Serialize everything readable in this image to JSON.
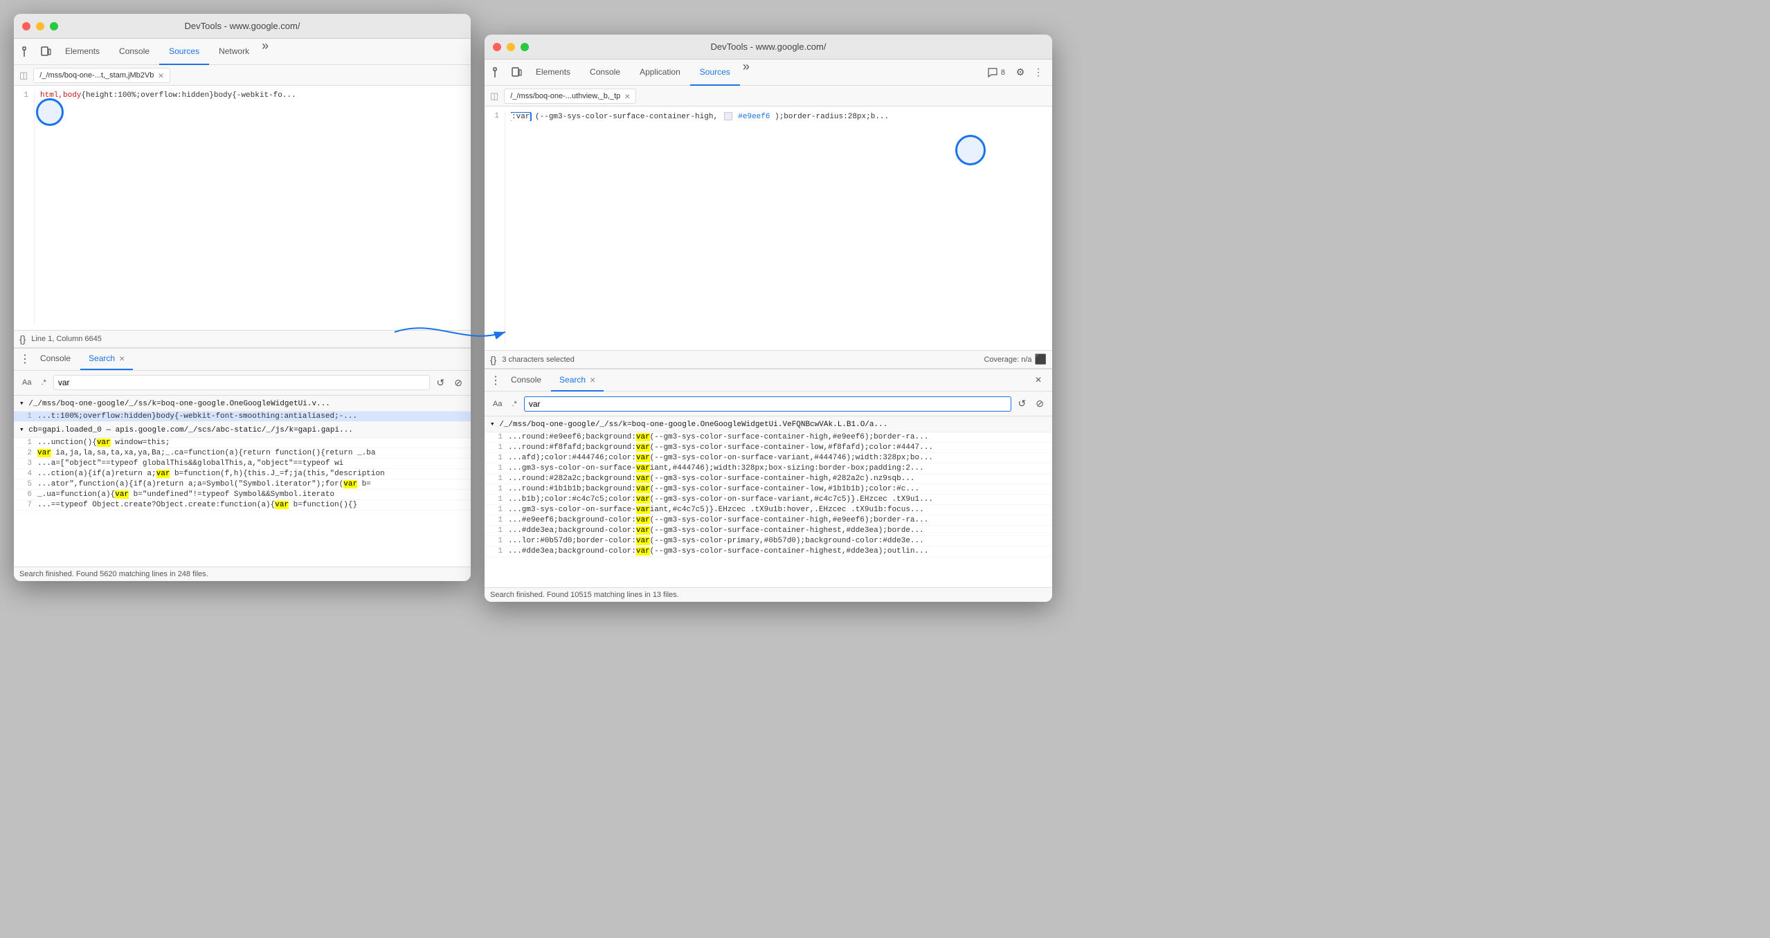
{
  "left_window": {
    "title": "DevTools - www.google.com/",
    "tabs": [
      {
        "label": "Elements",
        "active": false
      },
      {
        "label": "Console",
        "active": false
      },
      {
        "label": "Sources",
        "active": true
      },
      {
        "label": "Network",
        "active": false
      }
    ],
    "more_tabs": "»",
    "file_tab": "/_/mss/boq-one-...t,_stam,jMb2Vb",
    "line_number": "1",
    "source_line": "html,body{height:100%;overflow:hidden}body{-webkit-fo...",
    "status": "Line 1, Column 6645",
    "bottom_tabs": [
      {
        "label": "Console",
        "active": false
      },
      {
        "label": "Search",
        "active": true
      }
    ],
    "search": {
      "aa_label": "Aa",
      "regex_label": ".*",
      "input_value": "var",
      "refresh_btn": "↺",
      "clear_btn": "⊘"
    },
    "search_results": {
      "file1": {
        "path": "▾ /_/mss/boq-one-google/_/ss/k=boq-one-google.OneGoogleWidgetUi.v...",
        "lines": [
          {
            "num": "1",
            "text": "...t:100%;overflow:hidden}body{-webkit-font-smoothing:antialiased;-...",
            "highlight_word": "var"
          }
        ]
      },
      "file2": {
        "path": "▾ cb=gapi.loaded_0  —  apis.google.com/_/scs/abc-static/_/js/k=gapi.gapi...",
        "lines": [
          {
            "num": "1",
            "text": "...unction(){",
            "highlight_word": "var",
            "text_after": " window=this;"
          },
          {
            "num": "2",
            "text": "",
            "highlight_word": "var",
            "text_prefix": " ia,ja,la,sa,ta,xa,ya,Ba;_.ca=function(a){return function(){return _ba"
          },
          {
            "num": "3",
            "text": "...a=[\"object\"==typeof globalThis&&globalThis,a,\"object\"==typeof wi",
            "highlight_word": ""
          },
          {
            "num": "4",
            "text": "...ction(a){if(a)return a;",
            "highlight_word": "var",
            "text_after": " b=function(f,h){this.J_=f;ja(this,\"description"
          },
          {
            "num": "5",
            "text": "...ator\",function(a){if(a)return a;a=Symbol(\"Symbol.iterator\");for(",
            "highlight_word": "var",
            "text_after": " b="
          },
          {
            "num": "6",
            "text": "_.ua=function(a){",
            "highlight_word": "var",
            "text_after": " b=\"undefined\"!=typeof Symbol&&Symbol.iterato"
          },
          {
            "num": "7",
            "text": "...==typeof Object.create?Object.create:function(a){",
            "highlight_word": "var",
            "text_after": " b=function(){}"
          }
        ]
      }
    },
    "search_footer": "Search finished.  Found 5620 matching lines in 248 files."
  },
  "right_window": {
    "title": "DevTools - www.google.com/",
    "tabs": [
      {
        "label": "Elements",
        "active": false
      },
      {
        "label": "Console",
        "active": false
      },
      {
        "label": "Application",
        "active": false
      },
      {
        "label": "Sources",
        "active": true
      }
    ],
    "more_tabs": "»",
    "badge_count": "8",
    "file_tab": "/_/mss/boq-one-...uthview,_b,_tp",
    "line_number": "1",
    "source_line": ":var(--gm3-sys-color-surface-container-high,",
    "source_color_swatch": "#e9eef6",
    "source_line_suffix": ");border-radius:28px;b...",
    "selected_chars": "3 characters selected",
    "coverage": "Coverage: n/a",
    "status": "3 characters selected",
    "bottom_tabs": [
      {
        "label": "Console",
        "active": false
      },
      {
        "label": "Search",
        "active": true
      }
    ],
    "search": {
      "aa_label": "Aa",
      "regex_label": ".*",
      "input_value": "var",
      "refresh_btn": "↺",
      "clear_btn": "⊘"
    },
    "search_results": {
      "file1": {
        "path": "▾ /_/mss/boq-one-google/_/ss/k=boq-one-google.OneGoogleWidgetUi.VeFQNBcwVAk.L.B1.O/a...",
        "lines": [
          {
            "num": "1",
            "text_prefix": "...round:#e9eef6;background:",
            "highlight_word": "var",
            "text_after": "(--gm3-sys-color-surface-container-high,#e9eef6);border-ra..."
          },
          {
            "num": "1",
            "text_prefix": "...round:#f8fafd;background:",
            "highlight_word": "var",
            "text_after": "(--gm3-sys-color-surface-container-low,#f8fafd);color:#4447..."
          },
          {
            "num": "1",
            "text_prefix": "...afd);color:#444746;color:",
            "highlight_word": "var",
            "text_after": "(--gm3-sys-color-on-surface-variant,#444746);width:328px;bo..."
          },
          {
            "num": "1",
            "text_prefix": "...gm3-sys-color-on-surface-variant,#444746);width:328px;box-sizing:border-box;padding:2..."
          },
          {
            "num": "1",
            "text_prefix": "...round:#282a2c;background:",
            "highlight_word": "var",
            "text_after": "(--gm3-sys-color-surface-container-high,#282a2c).nz9sqb..."
          },
          {
            "num": "1",
            "text_prefix": "...round:#1b1b1b;background:",
            "highlight_word": "var",
            "text_after": "(--gm3-sys-color-surface-container-low,#1b1b1b);color:#c..."
          },
          {
            "num": "1",
            "text_prefix": "...b1b);color:#c4c7c5;color:",
            "highlight_word": "var",
            "text_after": "(--gm3-sys-color-on-surface-variant,#c4c7c5)}.EHzcec .tX9u1..."
          },
          {
            "num": "1",
            "text_prefix": "...gm3-sys-color-on-surface-variant,#c4c7c5)}.EHzcec .tX9u1b:hover,.EHzcec .tX9u1b:focus..."
          },
          {
            "num": "1",
            "text_prefix": "...#e9eef6;background-color:",
            "highlight_word": "var",
            "text_after": "(--gm3-sys-color-surface-container-high,#e9eef6);border-ra..."
          },
          {
            "num": "1",
            "text_prefix": "...#dde3ea;background-color:",
            "highlight_word": "var",
            "text_after": "(--gm3-sys-color-surface-container-highest,#dde3ea);borde..."
          },
          {
            "num": "1",
            "text_prefix": "...lor:#0b57d0;border-color:",
            "highlight_word": "var",
            "text_after": "(--gm3-sys-color-primary,#0b57d0);background-color:#dde3e..."
          },
          {
            "num": "1",
            "text_prefix": "...#dde3ea;background-color:",
            "highlight_word": "var",
            "text_after": "(--gm3-sys-color-surface-container-highest,#dde3ea);outlin..."
          }
        ]
      }
    },
    "search_footer": "Search finished.  Found 10515 matching lines in 13 files."
  },
  "icons": {
    "inspect": "⬚",
    "device": "☐",
    "kebab": "⋮",
    "gear": "⚙",
    "chat": "💬",
    "close": "×",
    "refresh": "↺",
    "clear": "⊘",
    "coverage_icon": "⬛"
  }
}
